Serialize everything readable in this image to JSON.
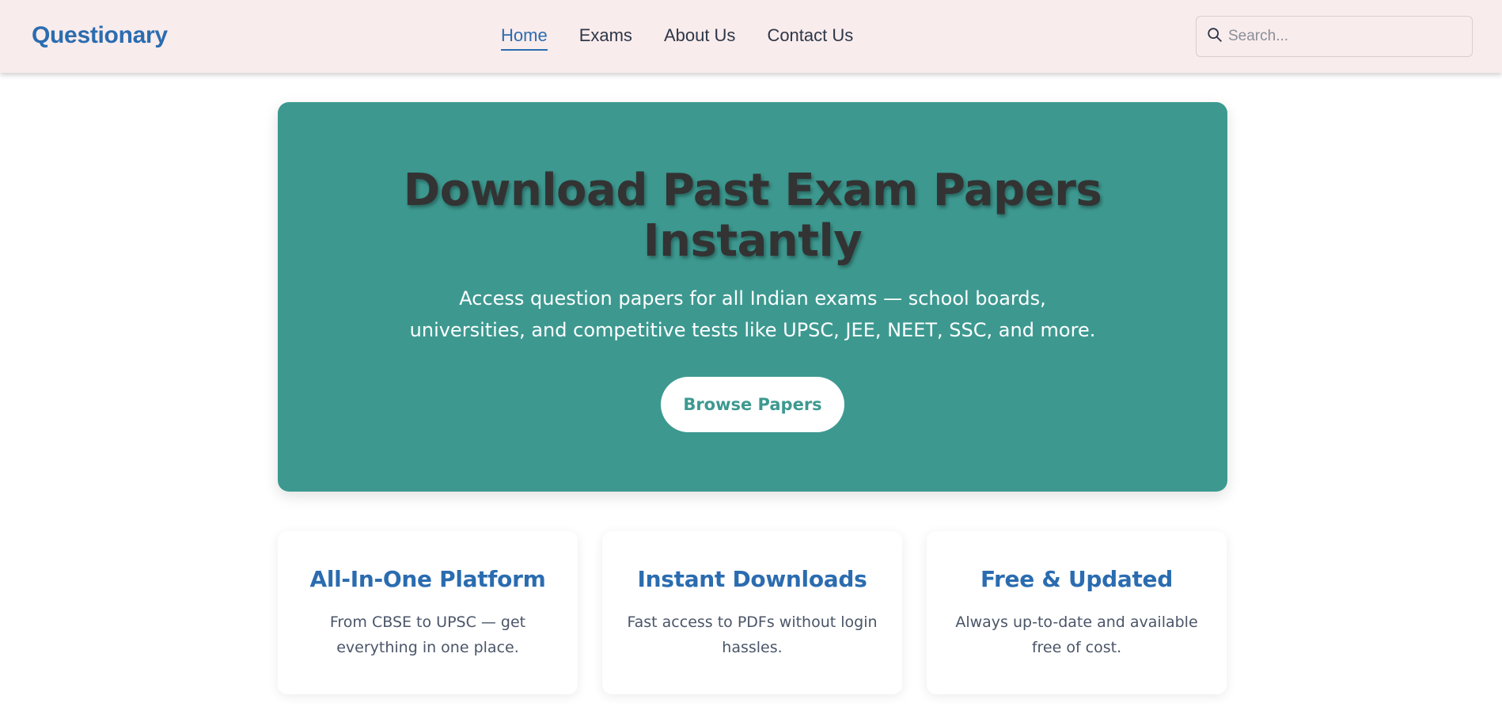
{
  "header": {
    "logo": "Questionary",
    "nav": [
      {
        "label": "Home",
        "active": true
      },
      {
        "label": "Exams",
        "active": false
      },
      {
        "label": "About Us",
        "active": false
      },
      {
        "label": "Contact Us",
        "active": false
      }
    ],
    "search": {
      "placeholder": "Search...",
      "value": "",
      "icon": "search-icon"
    }
  },
  "hero": {
    "title": "Download Past Exam Papers Instantly",
    "subtitle": "Access question papers for all Indian exams — school boards, universities, and competitive tests like UPSC, JEE, NEET, SSC, and more.",
    "button_label": "Browse Papers"
  },
  "features": [
    {
      "title": "All-In-One Platform",
      "text": "From CBSE to UPSC — get everything in one place."
    },
    {
      "title": "Instant Downloads",
      "text": "Fast access to PDFs without login hassles."
    },
    {
      "title": "Free & Updated",
      "text": "Always up-to-date and available free of cost."
    }
  ],
  "colors": {
    "header_bg": "#f9ecec",
    "brand": "#2b6cb0",
    "hero_bg": "#3d9990",
    "hero_title": "#333333",
    "card_text": "#4a5568"
  }
}
